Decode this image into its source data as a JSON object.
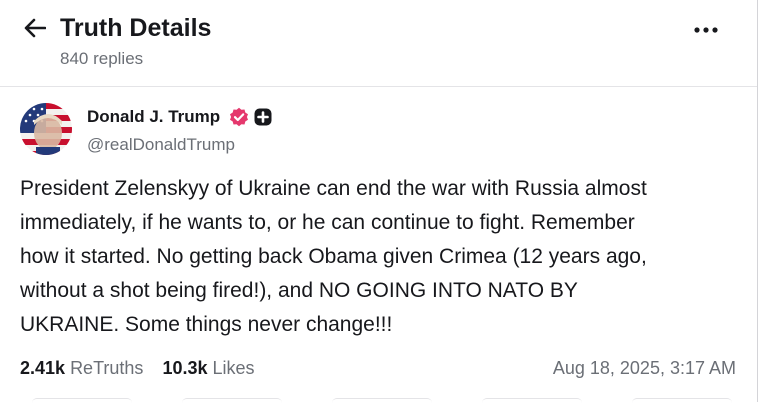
{
  "header": {
    "title": "Truth Details",
    "replies": "840 replies",
    "back_icon": "arrow-left-icon",
    "more_icon": "more-horizontal-icon"
  },
  "post": {
    "author": "Donald J. Trump",
    "handle": "@realDonaldTrump",
    "verified_color": "#e5386d",
    "body_lines": [
      "President Zelenskyy of Ukraine can end the war with Russia almost",
      "immediately, if he wants to, or he can continue to fight. Remember",
      "how it started. No getting back Obama given Crimea (12 years ago,",
      "without a shot being fired!), and NO GOING INTO NATO BY",
      "UKRAINE. Some things never change!!!"
    ],
    "retruths_count": "2.41k",
    "retruths_label": "ReTruths",
    "likes_count": "10.3k",
    "likes_label": "Likes",
    "timestamp": "Aug 18, 2025, 3:17 AM"
  },
  "colors": {
    "text": "#17181c",
    "muted": "#6b6f76",
    "divider": "#e4e4e7"
  }
}
